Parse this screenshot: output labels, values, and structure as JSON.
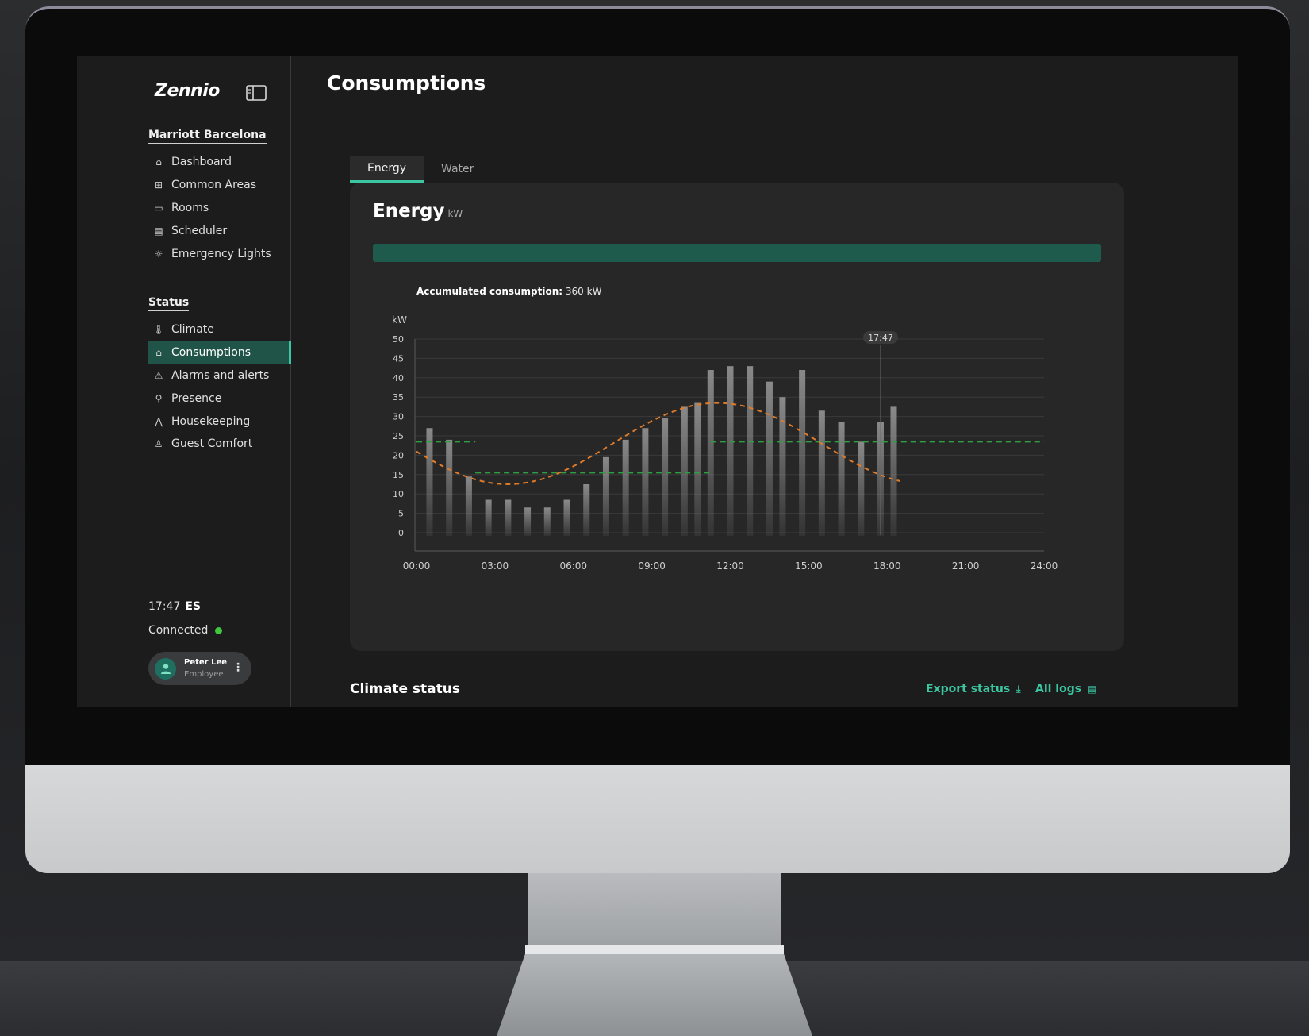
{
  "brand": {
    "name": "Zennio"
  },
  "sidebar": {
    "building": "Marriott Barcelona",
    "items": [
      {
        "label": "Dashboard",
        "icon": "home-icon"
      },
      {
        "label": "Common Areas",
        "icon": "common-areas-icon"
      },
      {
        "label": "Rooms",
        "icon": "bed-icon"
      },
      {
        "label": "Scheduler",
        "icon": "calendar-icon"
      },
      {
        "label": "Emergency Lights",
        "icon": "light-icon"
      }
    ],
    "status_title": "Status",
    "status_items": [
      {
        "label": "Climate",
        "icon": "thermometer-icon"
      },
      {
        "label": "Consumptions",
        "icon": "home-icon",
        "active": true
      },
      {
        "label": "Alarms and alerts",
        "icon": "warning-icon"
      },
      {
        "label": "Presence",
        "icon": "presence-icon"
      },
      {
        "label": "Housekeeping",
        "icon": "housekeeping-icon"
      },
      {
        "label": "Guest Comfort",
        "icon": "comfort-icon"
      }
    ],
    "time": "17:47",
    "language": "ES",
    "connection": "Connected",
    "user": {
      "name": "Peter Lee",
      "role": "Employee"
    }
  },
  "header": {
    "title": "Consumptions"
  },
  "tabs": [
    {
      "label": "Energy",
      "active": true
    },
    {
      "label": "Water",
      "active": false
    }
  ],
  "card": {
    "title": "Energy",
    "unit": "kW",
    "progress": 1.0
  },
  "accumulated": {
    "label": "Accumulated consumption:",
    "value": "360 kW"
  },
  "chart_data": {
    "type": "bar",
    "ylabel": "kW",
    "ylim": [
      0,
      50
    ],
    "yticks": [
      0,
      5,
      10,
      15,
      20,
      25,
      30,
      35,
      40,
      45,
      50
    ],
    "xlim": [
      0,
      24
    ],
    "xticks": [
      "00:00",
      "03:00",
      "06:00",
      "09:00",
      "12:00",
      "15:00",
      "18:00",
      "21:00",
      "24:00"
    ],
    "bar_hours": [
      0.5,
      1,
      1.5,
      2,
      2.5,
      3,
      3.5,
      4,
      4.5,
      5,
      5.5,
      6,
      6.5,
      7,
      7.5,
      8,
      8.5,
      9,
      9.5,
      10,
      10.5,
      11,
      11.5,
      12,
      12.5,
      13,
      13.5,
      14,
      14.5,
      15,
      15.5,
      16,
      16.5,
      17,
      17.5
    ],
    "values": [
      27,
      24,
      14.5,
      8.5,
      8.5,
      6.5,
      6.5,
      8.5,
      12.5,
      19.5,
      24,
      27,
      29.5,
      32.5,
      33.5,
      42,
      43,
      43,
      39,
      35,
      42,
      31.5,
      28.5,
      23.5,
      28.5,
      32.5
    ],
    "value_hours": [
      0.5,
      1.25,
      2,
      2.75,
      3.5,
      4.25,
      5,
      5.75,
      6.5,
      7.25,
      8,
      8.75,
      9.5,
      10.25,
      10.75,
      11.25,
      12,
      12.75,
      13.5,
      14,
      14.75,
      15.5,
      16.25,
      17,
      17.75,
      18.25
    ],
    "reference_lines": [
      {
        "from": 0,
        "to": 2.25,
        "value": 23.5,
        "color": "#2ea043"
      },
      {
        "from": 2.25,
        "to": 11.25,
        "value": 15.5,
        "color": "#2ea043"
      },
      {
        "from": 11.25,
        "to": 25.5,
        "value": 23.5,
        "color": "#2ea043"
      }
    ],
    "trend": {
      "color": "#e07b2a",
      "from": 0,
      "to": 18.5,
      "mean": 23,
      "amplitude": 10.5,
      "min_at": 3.5
    },
    "current_marker": {
      "hour": 17.75,
      "label": "17:47"
    },
    "colors": {
      "bar": "#8a8a8a",
      "grid": "#3a3a3a"
    }
  },
  "climate": {
    "title": "Climate status"
  },
  "actions": {
    "export_label": "Export status",
    "logs_label": "All logs"
  }
}
